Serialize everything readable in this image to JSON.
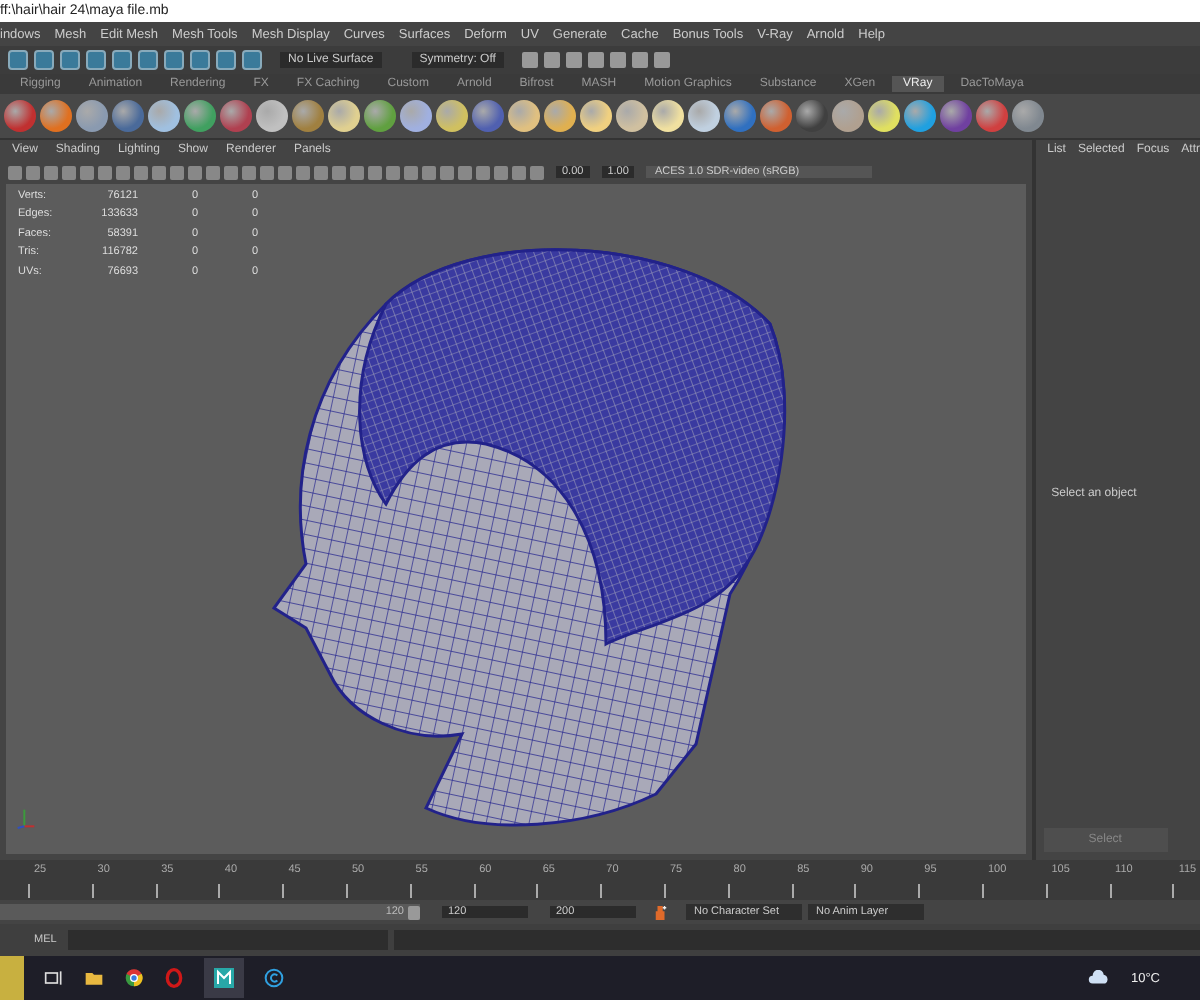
{
  "window": {
    "title": "ff:\\hair\\hair 24\\maya file.mb"
  },
  "menu_bar": [
    "indows",
    "Mesh",
    "Edit Mesh",
    "Mesh Tools",
    "Mesh Display",
    "Curves",
    "Surfaces",
    "Deform",
    "UV",
    "Generate",
    "Cache",
    "Bonus Tools",
    "V-Ray",
    "Arnold",
    "Help"
  ],
  "status_line": {
    "live_surface": "No Live Surface",
    "symmetry": "Symmetry: Off"
  },
  "shelf_tabs": [
    {
      "label": "Rigging",
      "selected": false
    },
    {
      "label": "Animation",
      "selected": false
    },
    {
      "label": "Rendering",
      "selected": false
    },
    {
      "label": "FX",
      "selected": false
    },
    {
      "label": "FX Caching",
      "selected": false
    },
    {
      "label": "Custom",
      "selected": false
    },
    {
      "label": "Arnold",
      "selected": false
    },
    {
      "label": "Bifrost",
      "selected": false
    },
    {
      "label": "MASH",
      "selected": false
    },
    {
      "label": "Motion Graphics",
      "selected": false
    },
    {
      "label": "Substance",
      "selected": false
    },
    {
      "label": "XGen",
      "selected": false
    },
    {
      "label": "VRay",
      "selected": true
    },
    {
      "label": "DacToMaya",
      "selected": false
    }
  ],
  "viewport": {
    "menu": [
      "View",
      "Shading",
      "Lighting",
      "Show",
      "Renderer",
      "Panels"
    ],
    "exposure": "0.00",
    "gamma": "1.00",
    "color_space": "ACES 1.0 SDR-video (sRGB)",
    "stats": [
      {
        "label": "Verts:",
        "values": [
          "76121",
          "0",
          "0"
        ]
      },
      {
        "label": "Edges:",
        "values": [
          "133633",
          "0",
          "0"
        ]
      },
      {
        "label": "Faces:",
        "values": [
          "58391",
          "0",
          "0"
        ]
      },
      {
        "label": "Tris:",
        "values": [
          "116782",
          "0",
          "0"
        ]
      },
      {
        "label": "UVs:",
        "values": [
          "76693",
          "0",
          "0"
        ]
      }
    ]
  },
  "side_panel": {
    "menu": [
      "List",
      "Selected",
      "Focus",
      "Attr"
    ],
    "message": "Select an object",
    "button": "Select"
  },
  "timeline": {
    "ticks": [
      "25",
      "30",
      "35",
      "40",
      "45",
      "50",
      "55",
      "60",
      "65",
      "70",
      "75",
      "80",
      "85",
      "90",
      "95",
      "100",
      "105",
      "110",
      "115"
    ]
  },
  "range": {
    "level": 1,
    "slider_end": "120",
    "end": "120",
    "max": "200",
    "character_set": "No Character Set",
    "anim_layer": "No Anim Layer"
  },
  "command_line": {
    "language": "MEL"
  },
  "taskbar": {
    "temperature": "10°C"
  }
}
